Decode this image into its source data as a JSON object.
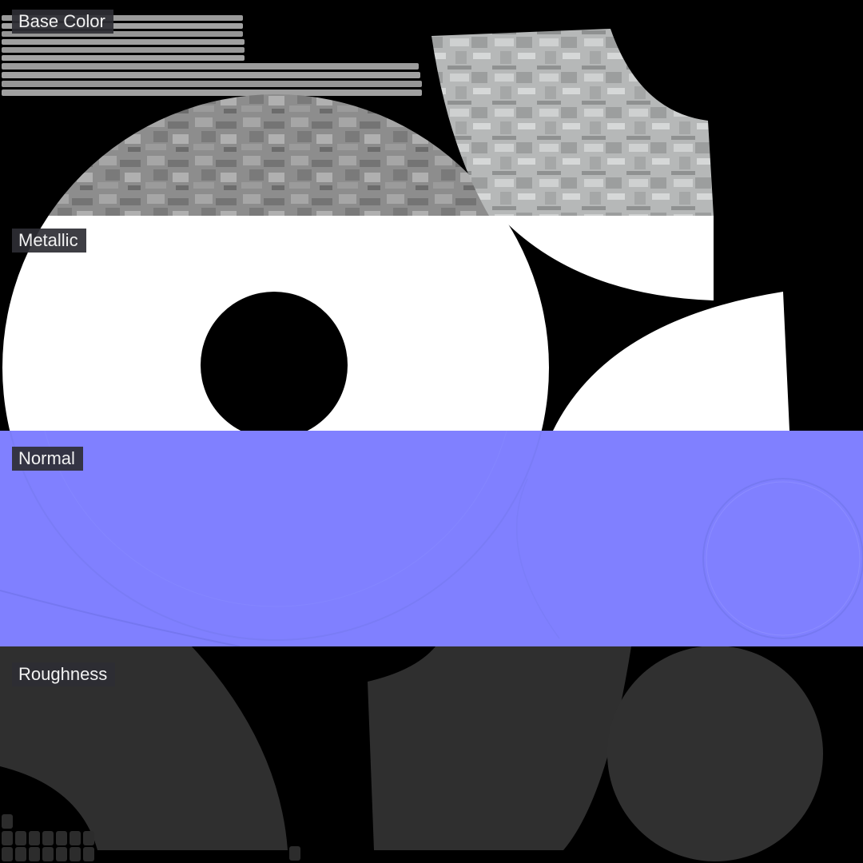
{
  "panels": [
    {
      "label": "Base Color",
      "color": "#8f8f8f"
    },
    {
      "label": "Metallic",
      "color": "#ffffff"
    },
    {
      "label": "Normal",
      "color": "#8080ff"
    },
    {
      "label": "Roughness",
      "color": "#2f2f2f"
    }
  ]
}
